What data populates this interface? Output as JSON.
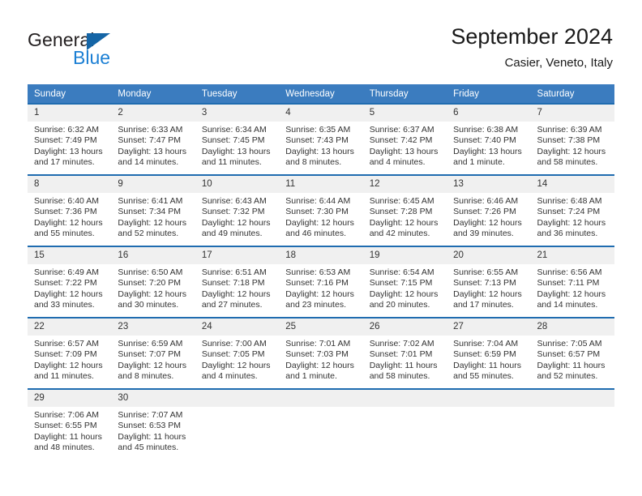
{
  "brand": {
    "name_part1": "General",
    "name_part2": "Blue",
    "logo_icon": "triangle-flag-icon",
    "color_primary": "#1565a6",
    "color_secondary": "#1b7fd4"
  },
  "header": {
    "title": "September 2024",
    "location": "Casier, Veneto, Italy"
  },
  "theme": {
    "header_row_bg": "#3b7cbf",
    "cell_top_border": "#1f6cb0",
    "daynum_bg": "#f0f0f0",
    "text": "#333333"
  },
  "calendar": {
    "weekday_headers": [
      "Sunday",
      "Monday",
      "Tuesday",
      "Wednesday",
      "Thursday",
      "Friday",
      "Saturday"
    ],
    "weeks": [
      [
        {
          "day": "1",
          "sunrise": "Sunrise: 6:32 AM",
          "sunset": "Sunset: 7:49 PM",
          "daylight_line1": "Daylight: 13 hours",
          "daylight_line2": "and 17 minutes."
        },
        {
          "day": "2",
          "sunrise": "Sunrise: 6:33 AM",
          "sunset": "Sunset: 7:47 PM",
          "daylight_line1": "Daylight: 13 hours",
          "daylight_line2": "and 14 minutes."
        },
        {
          "day": "3",
          "sunrise": "Sunrise: 6:34 AM",
          "sunset": "Sunset: 7:45 PM",
          "daylight_line1": "Daylight: 13 hours",
          "daylight_line2": "and 11 minutes."
        },
        {
          "day": "4",
          "sunrise": "Sunrise: 6:35 AM",
          "sunset": "Sunset: 7:43 PM",
          "daylight_line1": "Daylight: 13 hours",
          "daylight_line2": "and 8 minutes."
        },
        {
          "day": "5",
          "sunrise": "Sunrise: 6:37 AM",
          "sunset": "Sunset: 7:42 PM",
          "daylight_line1": "Daylight: 13 hours",
          "daylight_line2": "and 4 minutes."
        },
        {
          "day": "6",
          "sunrise": "Sunrise: 6:38 AM",
          "sunset": "Sunset: 7:40 PM",
          "daylight_line1": "Daylight: 13 hours",
          "daylight_line2": "and 1 minute."
        },
        {
          "day": "7",
          "sunrise": "Sunrise: 6:39 AM",
          "sunset": "Sunset: 7:38 PM",
          "daylight_line1": "Daylight: 12 hours",
          "daylight_line2": "and 58 minutes."
        }
      ],
      [
        {
          "day": "8",
          "sunrise": "Sunrise: 6:40 AM",
          "sunset": "Sunset: 7:36 PM",
          "daylight_line1": "Daylight: 12 hours",
          "daylight_line2": "and 55 minutes."
        },
        {
          "day": "9",
          "sunrise": "Sunrise: 6:41 AM",
          "sunset": "Sunset: 7:34 PM",
          "daylight_line1": "Daylight: 12 hours",
          "daylight_line2": "and 52 minutes."
        },
        {
          "day": "10",
          "sunrise": "Sunrise: 6:43 AM",
          "sunset": "Sunset: 7:32 PM",
          "daylight_line1": "Daylight: 12 hours",
          "daylight_line2": "and 49 minutes."
        },
        {
          "day": "11",
          "sunrise": "Sunrise: 6:44 AM",
          "sunset": "Sunset: 7:30 PM",
          "daylight_line1": "Daylight: 12 hours",
          "daylight_line2": "and 46 minutes."
        },
        {
          "day": "12",
          "sunrise": "Sunrise: 6:45 AM",
          "sunset": "Sunset: 7:28 PM",
          "daylight_line1": "Daylight: 12 hours",
          "daylight_line2": "and 42 minutes."
        },
        {
          "day": "13",
          "sunrise": "Sunrise: 6:46 AM",
          "sunset": "Sunset: 7:26 PM",
          "daylight_line1": "Daylight: 12 hours",
          "daylight_line2": "and 39 minutes."
        },
        {
          "day": "14",
          "sunrise": "Sunrise: 6:48 AM",
          "sunset": "Sunset: 7:24 PM",
          "daylight_line1": "Daylight: 12 hours",
          "daylight_line2": "and 36 minutes."
        }
      ],
      [
        {
          "day": "15",
          "sunrise": "Sunrise: 6:49 AM",
          "sunset": "Sunset: 7:22 PM",
          "daylight_line1": "Daylight: 12 hours",
          "daylight_line2": "and 33 minutes."
        },
        {
          "day": "16",
          "sunrise": "Sunrise: 6:50 AM",
          "sunset": "Sunset: 7:20 PM",
          "daylight_line1": "Daylight: 12 hours",
          "daylight_line2": "and 30 minutes."
        },
        {
          "day": "17",
          "sunrise": "Sunrise: 6:51 AM",
          "sunset": "Sunset: 7:18 PM",
          "daylight_line1": "Daylight: 12 hours",
          "daylight_line2": "and 27 minutes."
        },
        {
          "day": "18",
          "sunrise": "Sunrise: 6:53 AM",
          "sunset": "Sunset: 7:16 PM",
          "daylight_line1": "Daylight: 12 hours",
          "daylight_line2": "and 23 minutes."
        },
        {
          "day": "19",
          "sunrise": "Sunrise: 6:54 AM",
          "sunset": "Sunset: 7:15 PM",
          "daylight_line1": "Daylight: 12 hours",
          "daylight_line2": "and 20 minutes."
        },
        {
          "day": "20",
          "sunrise": "Sunrise: 6:55 AM",
          "sunset": "Sunset: 7:13 PM",
          "daylight_line1": "Daylight: 12 hours",
          "daylight_line2": "and 17 minutes."
        },
        {
          "day": "21",
          "sunrise": "Sunrise: 6:56 AM",
          "sunset": "Sunset: 7:11 PM",
          "daylight_line1": "Daylight: 12 hours",
          "daylight_line2": "and 14 minutes."
        }
      ],
      [
        {
          "day": "22",
          "sunrise": "Sunrise: 6:57 AM",
          "sunset": "Sunset: 7:09 PM",
          "daylight_line1": "Daylight: 12 hours",
          "daylight_line2": "and 11 minutes."
        },
        {
          "day": "23",
          "sunrise": "Sunrise: 6:59 AM",
          "sunset": "Sunset: 7:07 PM",
          "daylight_line1": "Daylight: 12 hours",
          "daylight_line2": "and 8 minutes."
        },
        {
          "day": "24",
          "sunrise": "Sunrise: 7:00 AM",
          "sunset": "Sunset: 7:05 PM",
          "daylight_line1": "Daylight: 12 hours",
          "daylight_line2": "and 4 minutes."
        },
        {
          "day": "25",
          "sunrise": "Sunrise: 7:01 AM",
          "sunset": "Sunset: 7:03 PM",
          "daylight_line1": "Daylight: 12 hours",
          "daylight_line2": "and 1 minute."
        },
        {
          "day": "26",
          "sunrise": "Sunrise: 7:02 AM",
          "sunset": "Sunset: 7:01 PM",
          "daylight_line1": "Daylight: 11 hours",
          "daylight_line2": "and 58 minutes."
        },
        {
          "day": "27",
          "sunrise": "Sunrise: 7:04 AM",
          "sunset": "Sunset: 6:59 PM",
          "daylight_line1": "Daylight: 11 hours",
          "daylight_line2": "and 55 minutes."
        },
        {
          "day": "28",
          "sunrise": "Sunrise: 7:05 AM",
          "sunset": "Sunset: 6:57 PM",
          "daylight_line1": "Daylight: 11 hours",
          "daylight_line2": "and 52 minutes."
        }
      ],
      [
        {
          "day": "29",
          "sunrise": "Sunrise: 7:06 AM",
          "sunset": "Sunset: 6:55 PM",
          "daylight_line1": "Daylight: 11 hours",
          "daylight_line2": "and 48 minutes."
        },
        {
          "day": "30",
          "sunrise": "Sunrise: 7:07 AM",
          "sunset": "Sunset: 6:53 PM",
          "daylight_line1": "Daylight: 11 hours",
          "daylight_line2": "and 45 minutes."
        },
        {
          "day": "",
          "sunrise": "",
          "sunset": "",
          "daylight_line1": "",
          "daylight_line2": ""
        },
        {
          "day": "",
          "sunrise": "",
          "sunset": "",
          "daylight_line1": "",
          "daylight_line2": ""
        },
        {
          "day": "",
          "sunrise": "",
          "sunset": "",
          "daylight_line1": "",
          "daylight_line2": ""
        },
        {
          "day": "",
          "sunrise": "",
          "sunset": "",
          "daylight_line1": "",
          "daylight_line2": ""
        },
        {
          "day": "",
          "sunrise": "",
          "sunset": "",
          "daylight_line1": "",
          "daylight_line2": ""
        }
      ]
    ]
  }
}
